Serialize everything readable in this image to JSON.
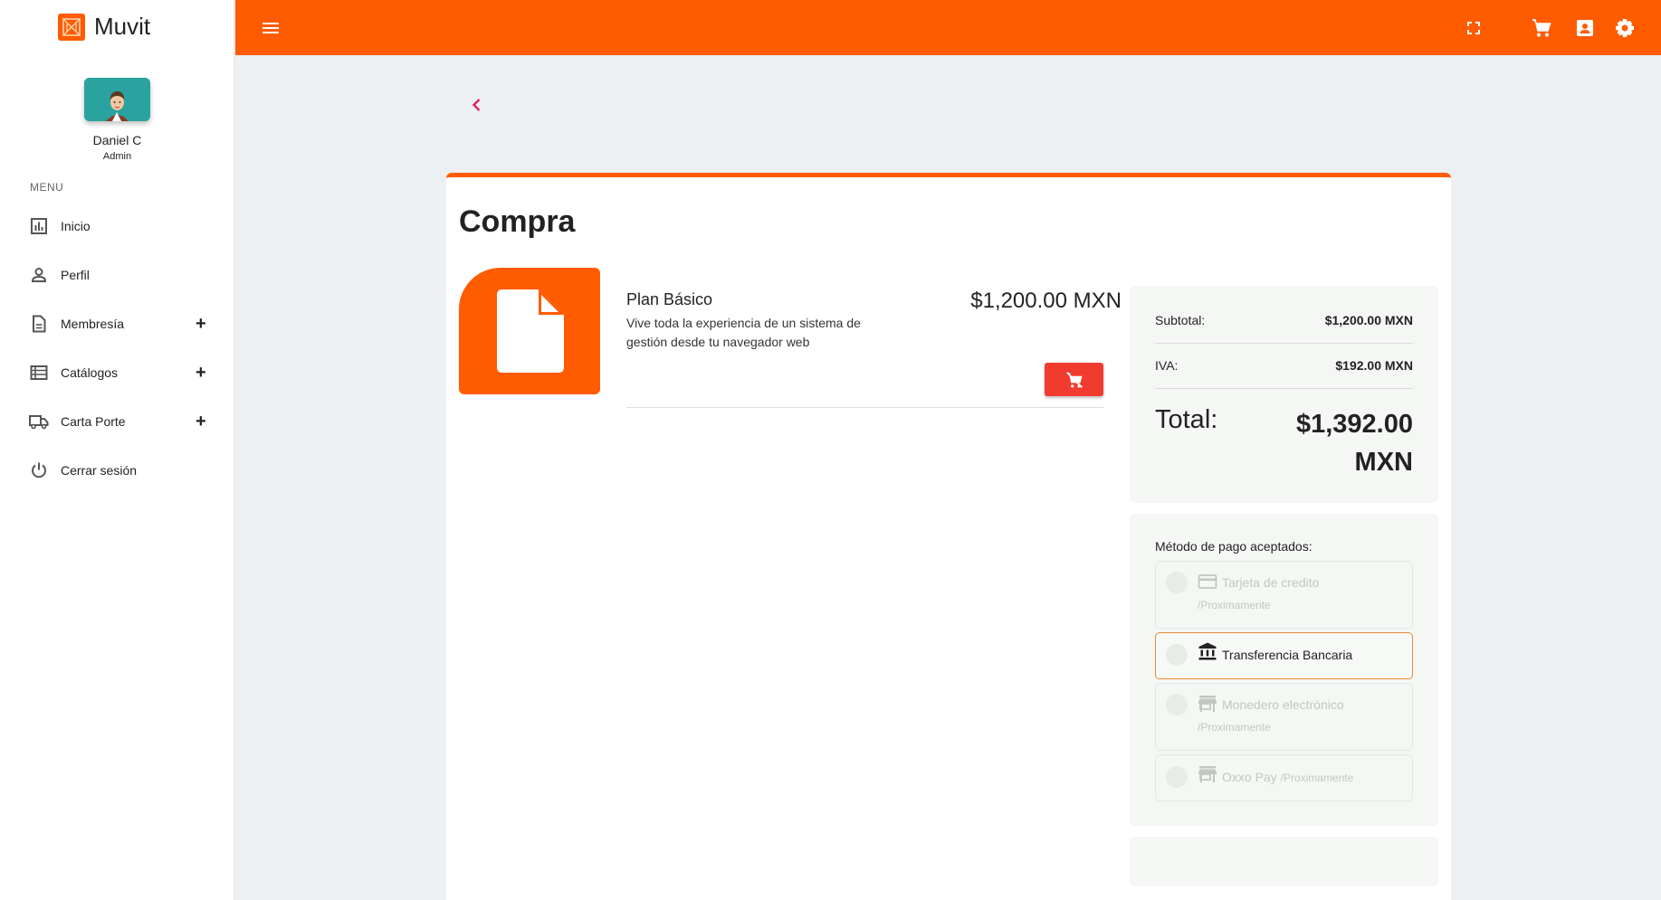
{
  "brand": {
    "name": "Muvit"
  },
  "user": {
    "name": "Daniel C",
    "role": "Admin"
  },
  "menu": {
    "heading": "MENU",
    "items": [
      {
        "label": "Inicio",
        "icon": "chart-icon",
        "expandable": false
      },
      {
        "label": "Perfil",
        "icon": "person-icon",
        "expandable": false
      },
      {
        "label": "Membresía",
        "icon": "document-icon",
        "expandable": true
      },
      {
        "label": "Catálogos",
        "icon": "list-icon",
        "expandable": true
      },
      {
        "label": "Carta Porte",
        "icon": "truck-icon",
        "expandable": true
      },
      {
        "label": "Cerrar sesión",
        "icon": "power-icon",
        "expandable": false
      }
    ],
    "plus_symbol": "+"
  },
  "topbar": {
    "color": "#ff5b00",
    "icons": [
      "menu-icon",
      "fullscreen-icon",
      "cart-icon",
      "contact-icon",
      "gear-icon"
    ]
  },
  "page": {
    "title": "Compra"
  },
  "product": {
    "name": "Plan Básico",
    "description": "Vive toda la experiencia de un sistema de gestión desde tu navegador web",
    "price": "$1,200.00 MXN"
  },
  "summary": {
    "subtotal_label": "Subtotal:",
    "subtotal_value": "$1,200.00 MXN",
    "iva_label": "IVA:",
    "iva_value": "$192.00 MXN",
    "total_label": "Total:",
    "total_amount": "$1,392.00",
    "total_currency": "MXN"
  },
  "payment": {
    "title": "Método de pago aceptados:",
    "options": [
      {
        "label": "Tarjeta de credito",
        "note": "/Proximamente",
        "icon": "credit-card-icon",
        "selected": false
      },
      {
        "label": "Transferencia Bancaria",
        "note": "",
        "icon": "bank-icon",
        "selected": true
      },
      {
        "label": "Monedero electrónico",
        "note": "/Proximamente",
        "icon": "store-icon",
        "selected": false
      },
      {
        "label": "Oxxo Pay",
        "note": "/Proximamente",
        "icon": "store-icon",
        "selected": false
      }
    ]
  },
  "colors": {
    "accent": "#ff5b00",
    "danger": "#f23b2f",
    "selected_border": "#e88a2c",
    "back_arrow": "#e91e63"
  }
}
